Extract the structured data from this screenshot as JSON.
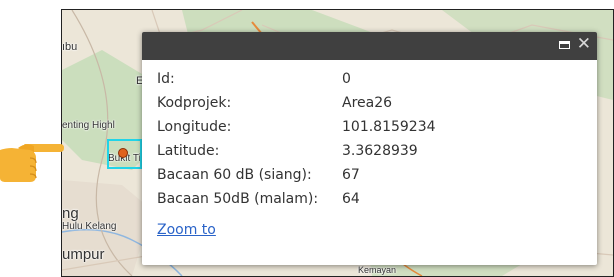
{
  "map": {
    "labels": {
      "abu": "ıbu",
      "genting": "enting Highl",
      "bukit": "Bukit Ti",
      "ng": "ng",
      "hulu": "Hulu Kelang",
      "lumpur": "umpur",
      "kemayan": "Kemayan",
      "e": "E"
    },
    "colors": {
      "land": "#ece6d8",
      "forest": "#c6dcb8",
      "road": "#d9c9b8",
      "highlight": "#21d4e8",
      "marker": "#e0621e"
    }
  },
  "popup": {
    "window_icons": [
      "maximize-icon",
      "close-icon"
    ],
    "close_glyph": "✕",
    "rows": [
      {
        "key": "Id:",
        "value": "0"
      },
      {
        "key": "Kodprojek:",
        "value": "Area26"
      },
      {
        "key": "Longitude:",
        "value": "101.8159234"
      },
      {
        "key": "Latitude:",
        "value": "3.3628939"
      },
      {
        "key": "Bacaan 60 dB (siang):",
        "value": "67"
      },
      {
        "key": "Bacaan 50dB (malam):",
        "value": "64"
      }
    ],
    "zoom_link": "Zoom to"
  },
  "pointer": {
    "icon": "pointing-hand-icon"
  }
}
